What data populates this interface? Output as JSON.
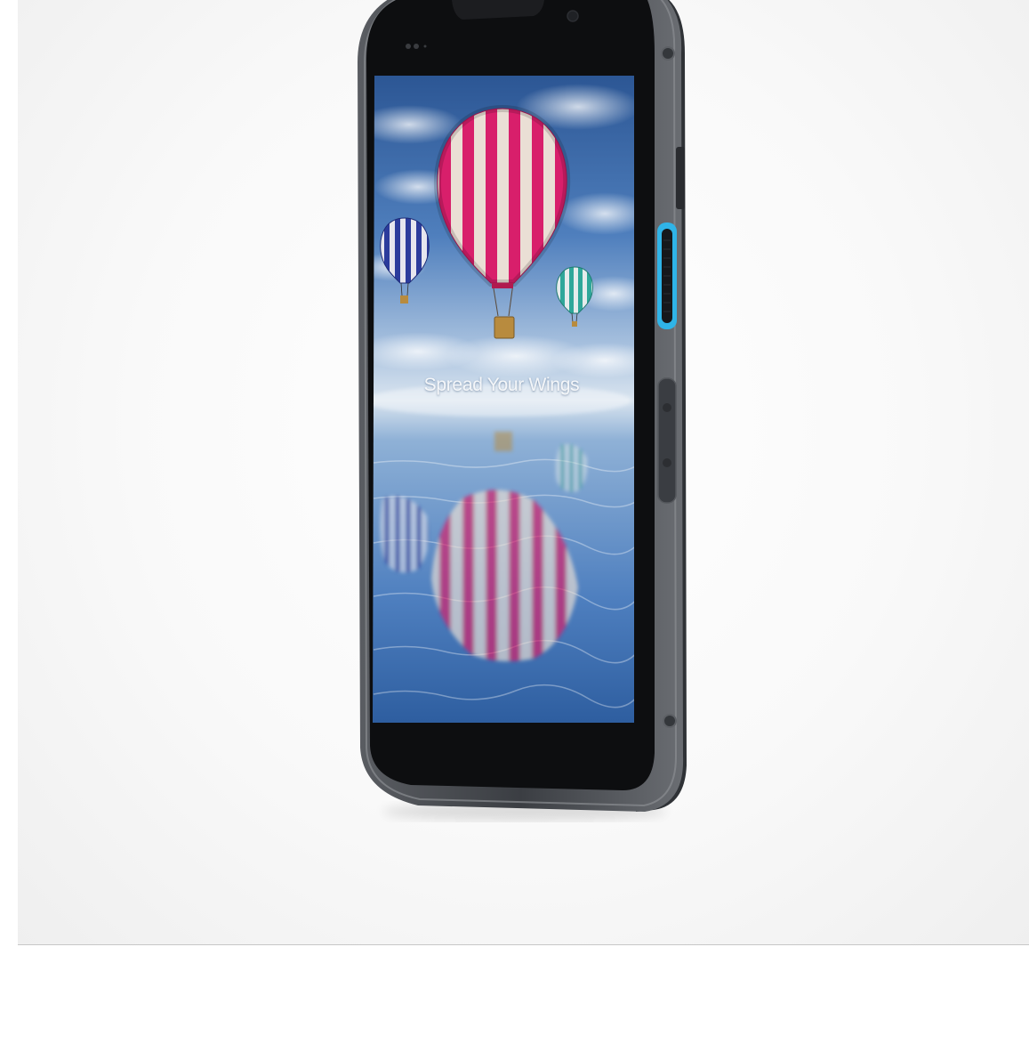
{
  "screen": {
    "wallpaper_caption": "Spread Your Wings"
  },
  "colors": {
    "background": "#f7f7f7",
    "phone_frame": "#4a4d52",
    "accent_scan_button": "#2fb4e8",
    "sky_top": "#2e5a99",
    "balloon_main": "#d81f6b",
    "balloon_left": "#2c3c9c",
    "balloon_right": "#2fa79a"
  },
  "icons": [
    "front-camera-icon",
    "proximity-sensor-icon",
    "speaker-grille-icon",
    "hot-air-balloon-icon"
  ]
}
